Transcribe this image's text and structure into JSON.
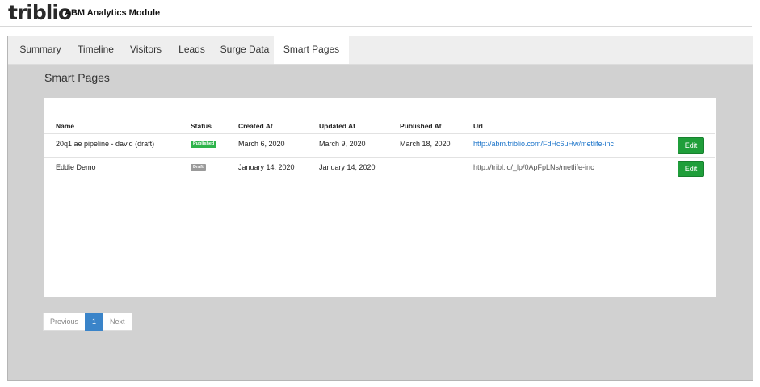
{
  "app": {
    "logo_text": "triblio",
    "title": "ABM Analytics Module"
  },
  "tabs": [
    {
      "label": "Summary"
    },
    {
      "label": "Timeline"
    },
    {
      "label": "Visitors"
    },
    {
      "label": "Leads"
    },
    {
      "label": "Surge Data"
    },
    {
      "label": "Smart Pages",
      "active": true
    }
  ],
  "section": {
    "title": "Smart Pages"
  },
  "table": {
    "columns": [
      "Name",
      "Status",
      "Created At",
      "Updated At",
      "Published At",
      "Url"
    ],
    "rows": [
      {
        "name": "20q1 ae pipeline - david (draft)",
        "status": "Published",
        "created_at": "March 6, 2020",
        "updated_at": "March 9, 2020",
        "published_at": "March 18, 2020",
        "url": "http://abm.triblio.com/FdHc6uHw/metlife-inc",
        "action": "Edit"
      },
      {
        "name": "Eddie Demo",
        "status": "Draft",
        "created_at": "January 14, 2020",
        "updated_at": "January 14, 2020",
        "published_at": "",
        "url": "http://tribl.io/_lp/0ApFpLNs/metlife-inc",
        "action": "Edit"
      }
    ]
  },
  "pagination": {
    "previous": "Previous",
    "current": "1",
    "next": "Next"
  },
  "colors": {
    "accent_green": "#1f9e3a",
    "link_blue": "#1a73c9",
    "pager_blue": "#3a84c9",
    "status_published": "#2eb44b",
    "status_draft": "#9a9a9a"
  }
}
